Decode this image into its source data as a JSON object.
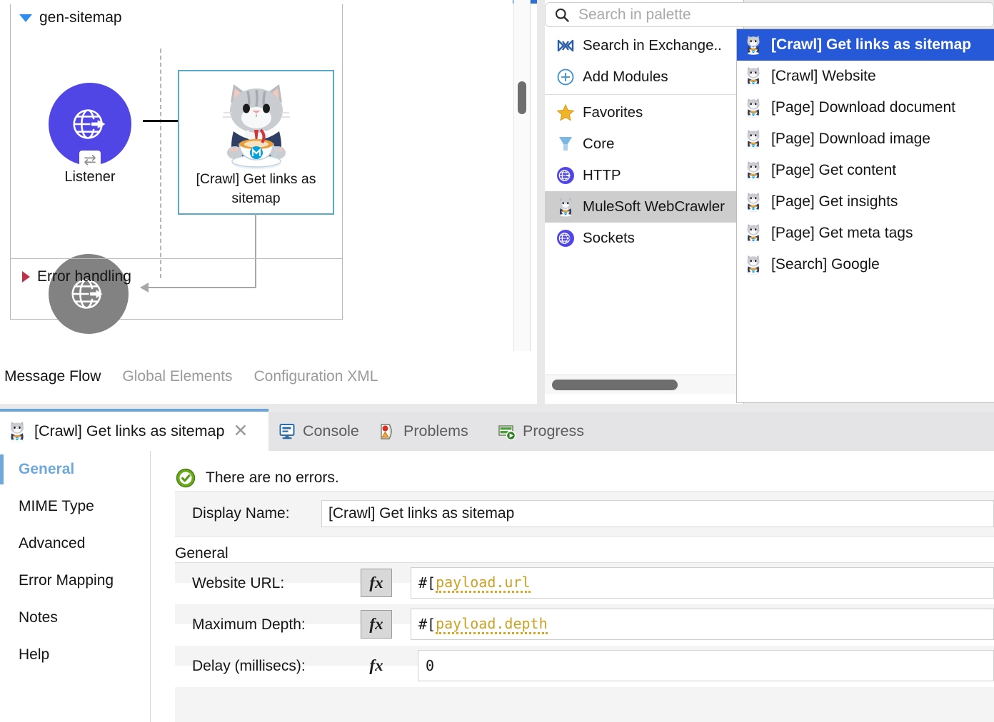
{
  "editor": {
    "flow": {
      "name": "gen-sitemap",
      "collapse_icon": "triangle-down-icon",
      "source": {
        "label": "Listener",
        "icon": "http-listener-icon",
        "badge_icon": "request-response-icon"
      },
      "processor": {
        "label": "[Crawl] Get links as sitemap",
        "icon": "mulesoft-webcrawler-cat-icon",
        "selected": true
      },
      "sink": {
        "icon": "http-listener-icon-disabled"
      },
      "error_handling": {
        "label": "Error handling",
        "icon": "triangle-right-icon"
      }
    },
    "tabs": [
      {
        "label": "Message Flow",
        "active": true
      },
      {
        "label": "Global Elements",
        "active": false
      },
      {
        "label": "Configuration XML",
        "active": false
      }
    ]
  },
  "palette": {
    "search": {
      "placeholder": "Search in palette",
      "value": "",
      "icon": "search-icon"
    },
    "top_items": [
      {
        "label": "Search in Exchange..",
        "icon": "exchange-icon"
      },
      {
        "label": "Add Modules",
        "icon": "plus-circle-icon"
      }
    ],
    "modules": [
      {
        "label": "Favorites",
        "icon": "star-icon",
        "selected": false
      },
      {
        "label": "Core",
        "icon": "core-icon",
        "selected": false
      },
      {
        "label": "HTTP",
        "icon": "http-icon",
        "selected": false
      },
      {
        "label": "MuleSoft WebCrawler",
        "icon": "mulesoft-webcrawler-cat-icon",
        "selected": true
      },
      {
        "label": "Sockets",
        "icon": "sockets-icon",
        "selected": false
      }
    ],
    "flyout": {
      "items": [
        {
          "label": "[Crawl] Get links as sitemap",
          "icon": "mulesoft-webcrawler-cat-icon",
          "selected": true
        },
        {
          "label": "[Crawl] Website",
          "icon": "mulesoft-webcrawler-cat-icon",
          "selected": false
        },
        {
          "label": "[Page] Download document",
          "icon": "mulesoft-webcrawler-cat-icon",
          "selected": false
        },
        {
          "label": "[Page] Download image",
          "icon": "mulesoft-webcrawler-cat-icon",
          "selected": false
        },
        {
          "label": "[Page] Get content",
          "icon": "mulesoft-webcrawler-cat-icon",
          "selected": false
        },
        {
          "label": "[Page] Get insights",
          "icon": "mulesoft-webcrawler-cat-icon",
          "selected": false
        },
        {
          "label": "[Page] Get meta tags",
          "icon": "mulesoft-webcrawler-cat-icon",
          "selected": false
        },
        {
          "label": "[Search] Google",
          "icon": "mulesoft-webcrawler-cat-icon",
          "selected": false
        }
      ]
    }
  },
  "properties": {
    "active_tab": {
      "label": "[Crawl] Get links as sitemap",
      "icon": "mulesoft-webcrawler-cat-icon",
      "close_icon": "close-icon"
    },
    "other_tabs": [
      {
        "label": "Console",
        "icon": "console-icon"
      },
      {
        "label": "Problems",
        "icon": "problems-icon"
      },
      {
        "label": "Progress",
        "icon": "progress-icon"
      }
    ],
    "sidebar": [
      {
        "label": "General",
        "active": true
      },
      {
        "label": "MIME Type",
        "active": false
      },
      {
        "label": "Advanced",
        "active": false
      },
      {
        "label": "Error Mapping",
        "active": false
      },
      {
        "label": "Notes",
        "active": false
      },
      {
        "label": "Help",
        "active": false
      }
    ],
    "status": {
      "text": "There are no errors.",
      "icon": "success-check-icon"
    },
    "display_name": {
      "label": "Display Name:",
      "value": "[Crawl] Get links as sitemap"
    },
    "section_title": "General",
    "fields": [
      {
        "label": "Website URL:",
        "fx_label": "fx",
        "fx_active": true,
        "prefix": "#[ ",
        "expr": "payload.url"
      },
      {
        "label": "Maximum Depth:",
        "fx_label": "fx",
        "fx_active": true,
        "prefix": "#[ ",
        "expr": "payload.depth"
      },
      {
        "label": "Delay (millisecs):",
        "fx_label": "fx",
        "fx_active": false,
        "prefix": "",
        "expr": "0"
      }
    ]
  },
  "colors": {
    "accent_blue": "#2559d8",
    "flow_top_blue": "#2f6fd0",
    "listener_purple": "#5046e5",
    "selection_teal": "#5aa8c8",
    "tab_underline": "#68a6d8",
    "expr_amber": "#c9a227"
  }
}
